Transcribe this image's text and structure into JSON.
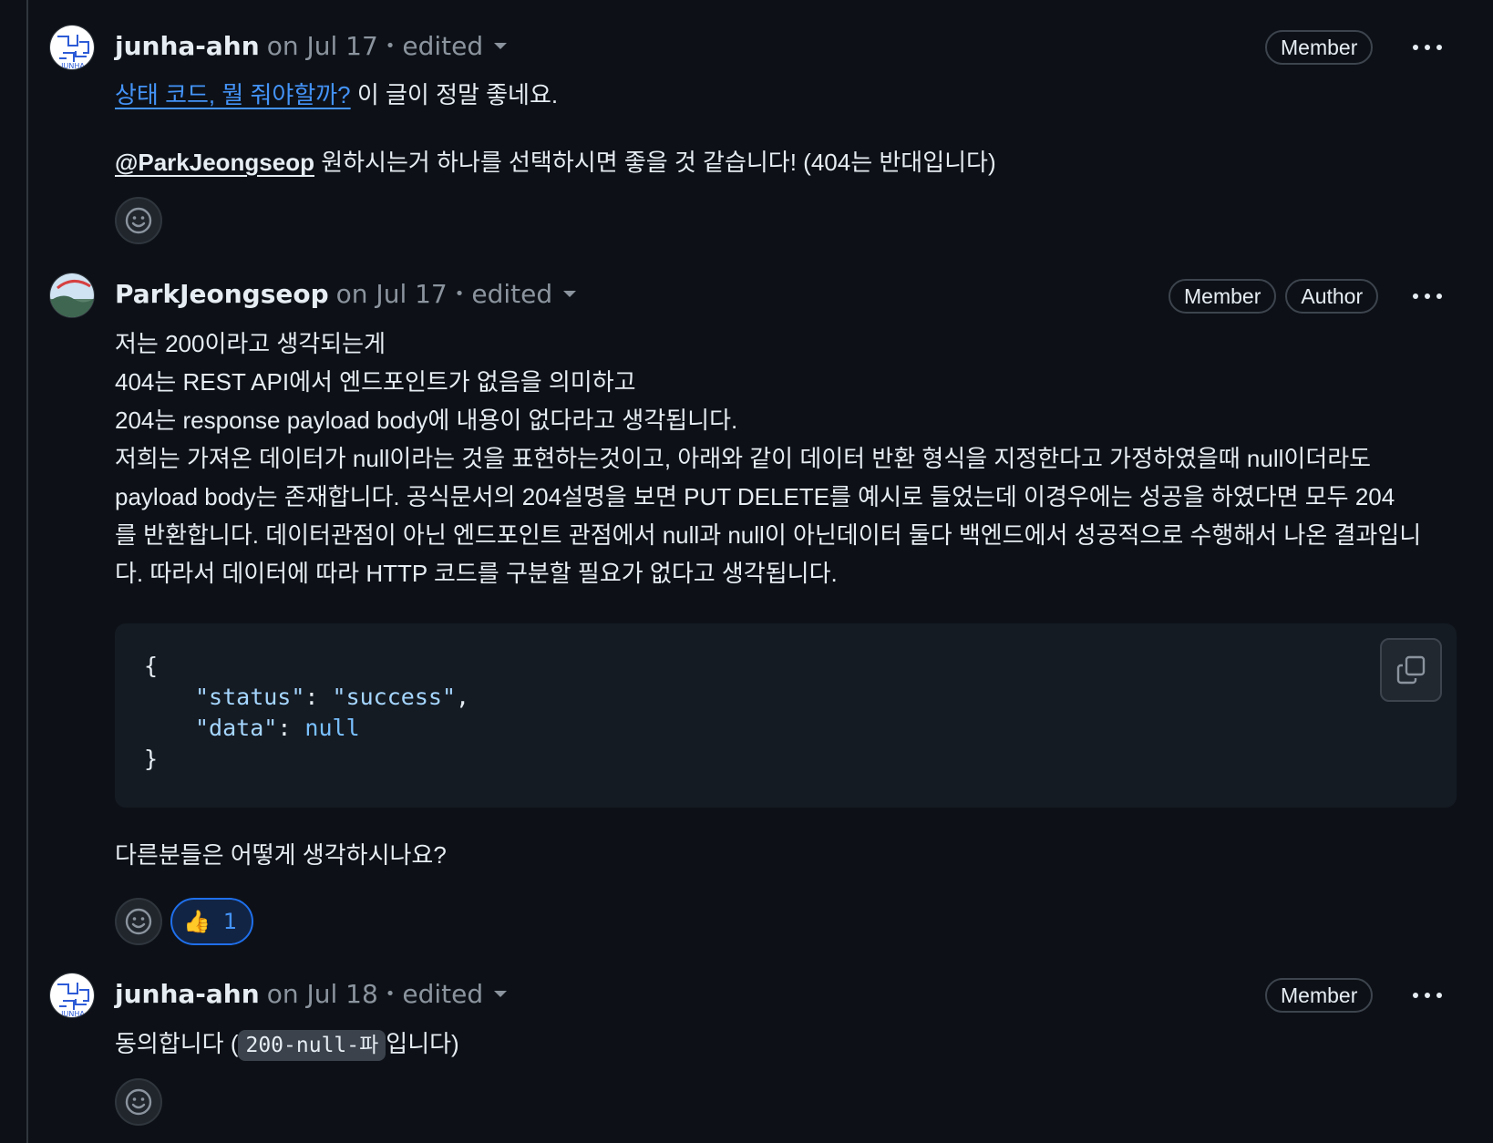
{
  "comments": [
    {
      "author": "junha-ahn",
      "date": "on Jul 17",
      "edited": "edited",
      "badges": [
        "Member"
      ],
      "link_text": "상태 코드, 뭘 줘야할까?",
      "line1_rest": " 이 글이 정말 좋네요.",
      "mention": "@ParkJeongseop",
      "line2_rest": " 원하시는거 하나를 선택하시면 좋을 것 같습니다! (404는 반대입니다)"
    },
    {
      "author": "ParkJeongseop",
      "date": "on Jul 17",
      "edited": "edited",
      "badges": [
        "Member",
        "Author"
      ],
      "lines": [
        "저는 200이라고 생각되는게",
        "404는 REST API에서 엔드포인트가 없음을 의미하고",
        "204는 response payload body에 내용이 없다라고 생각됩니다.",
        "저희는 가져온 데이터가 null이라는 것을 표현하는것이고, 아래와 같이 데이터 반환 형식을 지정한다고 가정하였을때 null이더라도",
        "payload body는 존재합니다. 공식문서의 204설명을 보면 PUT DELETE를 예시로 들었는데 이경우에는 성공을 하였다면 모두 204",
        "를 반환합니다. 데이터관점이 아닌 엔드포인트 관점에서 null과 null이 아닌데이터 둘다 백엔드에서 성공적으로 수행해서 나온 결과입니",
        "다. 따라서 데이터에 따라 HTTP 코드를 구분할 필요가 없다고 생각됩니다."
      ],
      "code": {
        "open": "{",
        "key1": "\"status\"",
        "val1": "\"success\"",
        "key2": "\"data\"",
        "val2": "null",
        "close": "}"
      },
      "closing": "다른분들은 어떻게 생각하시나요?",
      "reaction": {
        "emoji": "👍",
        "count": "1"
      }
    },
    {
      "author": "junha-ahn",
      "date": "on Jul 18",
      "edited": "edited",
      "badges": [
        "Member"
      ],
      "text_before": "동의합니다 (",
      "inline_code": "200-null-파",
      "text_after": "입니다)"
    }
  ],
  "icons": {
    "smiley": "smiley-icon",
    "kebab": "kebab-horizontal-icon",
    "copy": "copy-icon",
    "caret": "triangle-down-icon"
  },
  "colors": {
    "background": "#0d1117",
    "link": "#4493f8",
    "muted": "#8b949e",
    "reaction_border": "#1f6feb"
  }
}
